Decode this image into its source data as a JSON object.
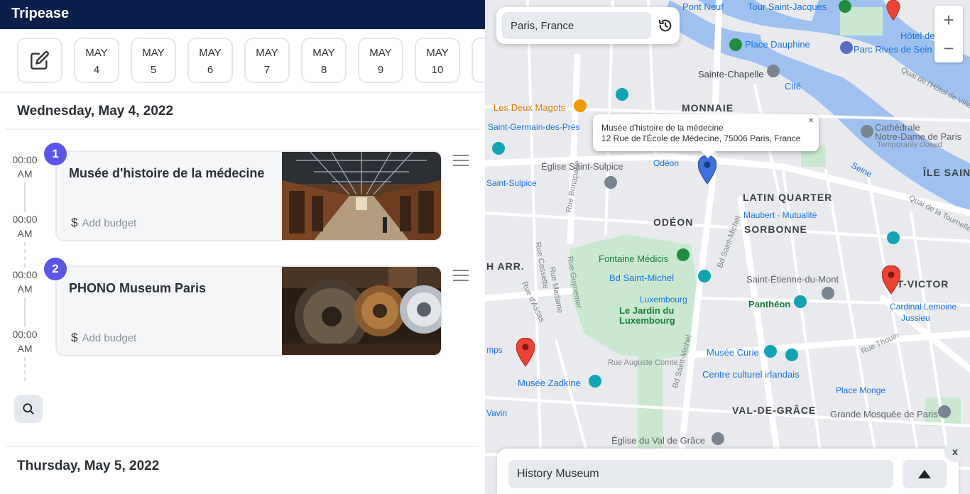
{
  "app": {
    "title": "Tripease"
  },
  "day_strip": {
    "days": [
      {
        "month": "MAY",
        "day": "4"
      },
      {
        "month": "MAY",
        "day": "5"
      },
      {
        "month": "MAY",
        "day": "6"
      },
      {
        "month": "MAY",
        "day": "7"
      },
      {
        "month": "MAY",
        "day": "8"
      },
      {
        "month": "MAY",
        "day": "9"
      },
      {
        "month": "MAY",
        "day": "10"
      }
    ]
  },
  "itinerary": {
    "day1_heading": "Wednesday, May 4, 2022",
    "day2_heading": "Thursday, May 5, 2022",
    "stops": [
      {
        "number": "1",
        "name": "Musée d'histoire de la médecine",
        "budget_label": "Add budget",
        "budget_symbol": "$",
        "start_time": "00:00",
        "start_ampm": "AM",
        "end_time": "00:00",
        "end_ampm": "AM"
      },
      {
        "number": "2",
        "name": "PHONO Museum Paris",
        "budget_label": "Add budget",
        "budget_symbol": "$",
        "start_time": "00:00",
        "start_ampm": "AM",
        "end_time": "00:00",
        "end_ampm": "AM"
      }
    ]
  },
  "map": {
    "location_value": "Paris, France",
    "zoom_in": "+",
    "zoom_out": "−",
    "info_window": {
      "title": "Musée d'histoire de la médecine",
      "address": "12 Rue de l'École de Médecine, 75006 Paris, France",
      "close": "×"
    },
    "search_value": "History Museum",
    "close_panel": "x",
    "labels": {
      "pont_neuf": "Pont Neuf",
      "tour_saint_jacques": "Tour Saint-Jacques",
      "hotel_de": "Hôtel de",
      "place_dauphine": "Place Dauphine",
      "parc_rives": "Parc Rives de Sein",
      "sainte_chapelle": "Sainte-Chapelle",
      "cite": "Cité",
      "monnaie": "MONNAIE",
      "deux_magots": "Les Deux Magots",
      "st_germain": "Saint-Germain-des-Prés",
      "cathedrale1": "Cathédrale",
      "cathedrale2": "Notre-Dame de Paris",
      "temp_closed": "Temporarily closed",
      "eglise_st_sulpice": "Église Saint-Sulpice",
      "odeon_metro": "Odéon",
      "saint_sulpice": "Saint-Sulpice",
      "latin_quarter": "LATIN QUARTER",
      "ile_saint": "ÎLE SAIN",
      "maubert": "Maubert - Mutualité",
      "odeon": "ODÉON",
      "sorbonne": "SORBONNE",
      "fontaine_medicis": "Fontaine Médicis",
      "arr": "H ARR.",
      "bd_saint_michel": "Bd Saint-Michel",
      "st_etienne": "Saint-Étienne-du-Mont",
      "st_victor": "ST-VICTOR",
      "luxembourg": "Luxembourg",
      "pantheon": "Panthéon",
      "cardinal": "Cardinal Lemoine",
      "jussieu": "Jussieu",
      "jardin1": "Le Jardin du",
      "jardin2": "Luxembourg",
      "musee_curie": "Musée Curie",
      "centre_culturel": "Centre culturel irlandais",
      "mps": "mps",
      "rue_auguste_comte": "Rue Auguste Comte",
      "musee_zadkine": "Musée Zadkine",
      "place_monge": "Place Monge",
      "val_de_grace": "VAL-DE-GRÂCE",
      "grande_mosquee": "Grande Mosquée de Paris",
      "vavin": "Vavin",
      "eglise_val": "Église du Val de Grâce",
      "rue_bonaparte": "Rue Bonaparte",
      "rue_cassette": "Rue Cassette",
      "rue_madame": "Rue Madame",
      "rue_guynemer": "Rue Guynemer",
      "rue_dassas": "Rue d'Assas",
      "rue_thouin": "Rue Thouin",
      "quai_hotel_ville": "Quai de l'Hôtel de Ville",
      "quai_tournelle": "Quai de la Tournelle",
      "seine": "Seine",
      "bd_saint_michel_v": "Bd Saint-Michel",
      "bd_saint_michel_v2": "Bd Saint-Michel"
    }
  }
}
